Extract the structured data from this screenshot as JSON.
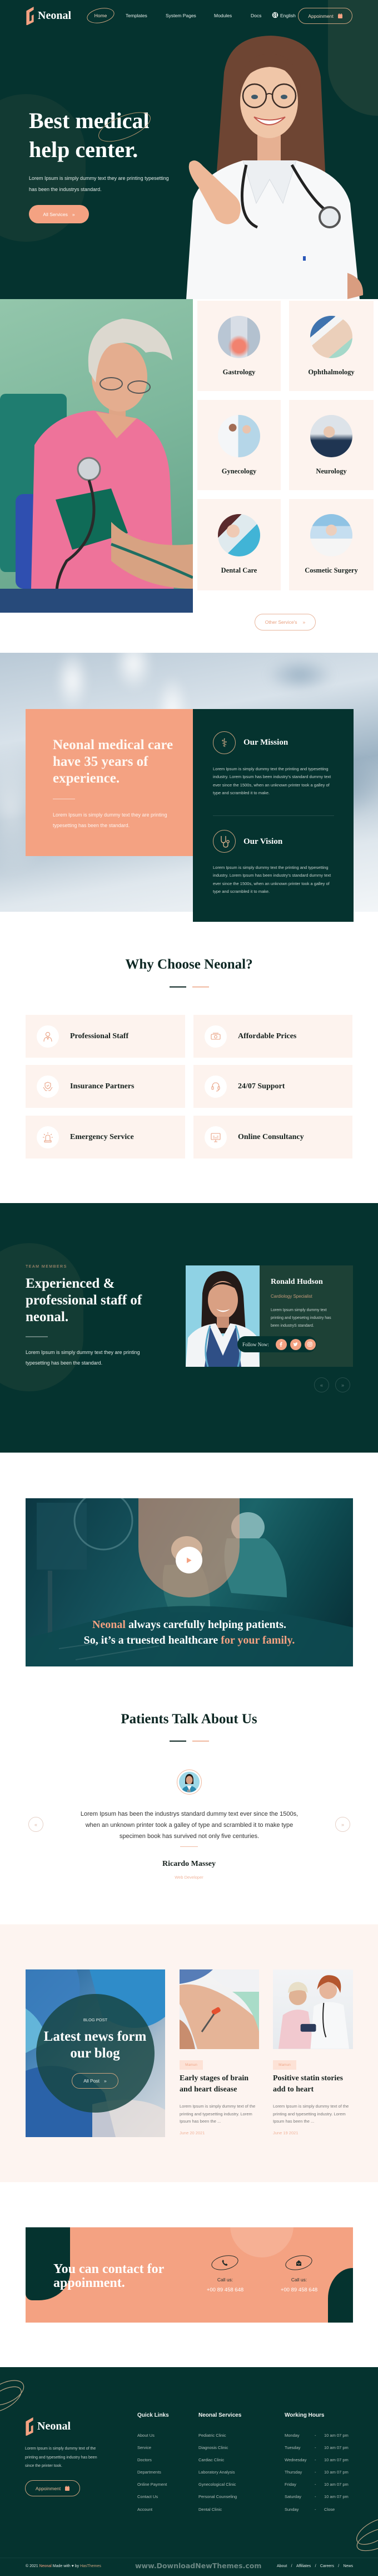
{
  "colors": {
    "dark_green": "#05332f",
    "peach": "#f4a282",
    "light_peach": "#fdf4f0",
    "gold_outline": "#c9a27e"
  },
  "brand": {
    "name": "Neonal"
  },
  "nav": {
    "items": [
      {
        "label": "Home",
        "active": true
      },
      {
        "label": "Templates"
      },
      {
        "label": "System Pages"
      },
      {
        "label": "Modules"
      },
      {
        "label": "Docs"
      }
    ],
    "language": "English",
    "language_icon": "globe-icon",
    "appointment_label": "Appoinment",
    "appointment_icon": "calendar-icon"
  },
  "hero": {
    "title_line1": "Best medical",
    "title_line2": "help center.",
    "description": "Lorem Ipsum is simply dummy text they are printing typesetting has been the industrys standard.",
    "cta_label": "All Services",
    "cta_icon": "double-chevron-right-icon"
  },
  "services": {
    "items": [
      {
        "label": "Gastrology"
      },
      {
        "label": "Ophthalmology"
      },
      {
        "label": "Gynecology"
      },
      {
        "label": "Neurology"
      },
      {
        "label": "Dental Care"
      },
      {
        "label": "Cosmetic Surgery"
      }
    ],
    "more_label": "Other Service's"
  },
  "about": {
    "heading": "Neonal medical care have 35 years of experience.",
    "description": "Lorem Ipsum is simply dummy text they are printing typesetting has been the standard.",
    "mission": {
      "title": "Our Mission",
      "icon": "caduceus-icon",
      "text": "Lorem Ipsum is simply dummy text the printing and typesetting industry. Lorem Ipsum has been industry's standard dummy text ever since the 1500s, when an unknown printer took a galley of type and scrambled it to make."
    },
    "vision": {
      "title": "Our Vision",
      "icon": "stethoscope-icon",
      "text": "Lorem Ipsum is simply dummy text the printing and typesetting industry. Lorem Ipsum has been industry's standard dummy text ever since the 1500s, when an unknown printer took a galley of type and scrambled it to make."
    }
  },
  "why_choose": {
    "title": "Why Choose Neonal?",
    "items": [
      {
        "label": "Professional Staff",
        "icon": "doctor-icon"
      },
      {
        "label": "Affordable Prices",
        "icon": "money-icon"
      },
      {
        "label": "Insurance Partners",
        "icon": "insurance-hands-icon"
      },
      {
        "label": "24/07 Support",
        "icon": "headset-icon"
      },
      {
        "label": "Emergency Service",
        "icon": "siren-icon"
      },
      {
        "label": "Online Consultancy",
        "icon": "monitor-icon"
      }
    ]
  },
  "team": {
    "eyebrow": "TEAM MEMBERS",
    "heading": "Experienced & professional staff of neonal.",
    "description": "Lorem Ipsum is simply dummy text they are printing typesetting has been the standard.",
    "member": {
      "name": "Ronald Hudson",
      "role": "Cardiology Specialist",
      "bio": "Lorem Ipsum simply dummy text printing and typesetng industry has been industryS standard.",
      "follow_label": "Follow Now:",
      "socials": [
        "facebook",
        "twitter",
        "instagram"
      ]
    }
  },
  "video": {
    "line1_highlight": "Neonal",
    "line1_rest": " always carefully helping patients.",
    "line2_rest": "So, it’s a truested healthcare ",
    "line2_highlight": "for your family.",
    "play_icon": "play-icon"
  },
  "testimonials": {
    "title": "Patients Talk About Us",
    "quote_mark": "“",
    "quote": "Lorem Ipsum has been the industrys standard dummy text ever since the 1500s, when an unknown printer took a galley of type and scrambled it to make type specimen book has survived not only five centuries.",
    "name": "Ricardo Massey",
    "role": "Web Developer"
  },
  "blog": {
    "eyebrow": "BLOG POST",
    "heading": "Latest news form our blog",
    "cta_label": "All Post",
    "posts": [
      {
        "tag": "Mamun",
        "title": "Early stages of brain and heart disease",
        "excerpt": "Lorem Ipsum is simply dummy text of the printing and typesetting industry. Lorem Ipsum has been the ...",
        "date": "June 20 2021"
      },
      {
        "tag": "Mamun",
        "title": "Positive statin stories add to heart",
        "excerpt": "Lorem Ipsum is simply dummy text of the printing and typesetting industry. Lorem Ipsum has been the ...",
        "date": "June 19 2021"
      }
    ]
  },
  "contact": {
    "heading": "You can contact for appoinment.",
    "items": [
      {
        "label": "Call us:",
        "value": "+00 89 458 648",
        "icon": "phone-icon"
      },
      {
        "label": "Call us:",
        "value": "+00 89 458 648",
        "icon": "mail-icon"
      }
    ]
  },
  "footer": {
    "about": "Lorem Ipsum is simply dummy text of the printing and typesetting industry has been since the printer took.",
    "cta_label": "Appoinment",
    "quick_links": {
      "title": "Quick Links",
      "items": [
        "About Us",
        "Service",
        "Doctors",
        "Departments",
        "Online Payment",
        "Contact Us",
        "Account"
      ]
    },
    "services": {
      "title": "Neonal Services",
      "items": [
        "Pediatric Clinic",
        "Diagnosis Clinic",
        "Cardiac Clinic",
        "Laboratory Analysis",
        "Gynecological Clinic",
        "Personal Counseling",
        "Dental Clinic"
      ]
    },
    "hours": {
      "title": "Working Hours",
      "rows": [
        {
          "day": "Monday",
          "sep": "-",
          "time": "10 am 07 pm"
        },
        {
          "day": "Tuesday",
          "sep": "-",
          "time": "10 am 07 pm"
        },
        {
          "day": "Wednesday",
          "sep": "-",
          "time": "10 am 07 pm"
        },
        {
          "day": "Thursday",
          "sep": "-",
          "time": "10 am 07 pm"
        },
        {
          "day": "Friday",
          "sep": "-",
          "time": "10 am 07 pm"
        },
        {
          "day": "Saturday",
          "sep": "-",
          "time": "10 am 07 pm"
        },
        {
          "day": "Sunday",
          "sep": "-",
          "time": "Close"
        }
      ]
    },
    "copyright": {
      "prefix": "© 2021",
      "brand": "Neonal",
      "made_with": "Made with",
      "by": "by",
      "author": "HasThemes"
    },
    "watermark": "www.DownloadNewThemes.com",
    "bottom_links": [
      "About",
      "Affiliates",
      "Careers",
      "News"
    ],
    "link_separator": "/"
  }
}
